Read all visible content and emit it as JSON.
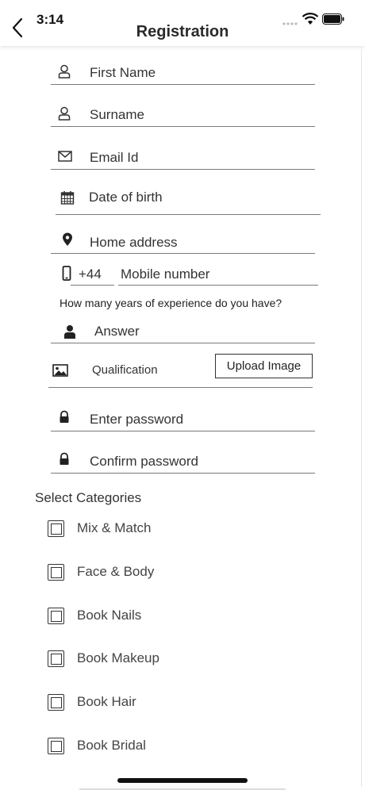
{
  "status": {
    "time": "3:14"
  },
  "header": {
    "title": "Registration"
  },
  "fields": {
    "first_name": "First Name",
    "surname": "Surname",
    "email": "Email Id",
    "dob": "Date of birth",
    "address": "Home address",
    "country_code": "+44",
    "mobile": "Mobile number",
    "experience_question": "How many years of experience do you have?",
    "answer": "Answer",
    "qualification": "Qualification",
    "upload_label": "Upload Image",
    "password": "Enter password",
    "confirm_password": "Confirm password"
  },
  "categories": {
    "title": "Select Categories",
    "items": [
      {
        "label": "Mix & Match",
        "checked": false
      },
      {
        "label": "Face & Body",
        "checked": false
      },
      {
        "label": "Book Nails",
        "checked": false
      },
      {
        "label": "Book Makeup",
        "checked": false
      },
      {
        "label": "Book Hair",
        "checked": false
      },
      {
        "label": "Book Bridal",
        "checked": false
      }
    ]
  },
  "icons": {
    "back": "chevron-left-icon",
    "wifi": "wifi-icon",
    "battery": "battery-icon",
    "user": "user-icon",
    "email": "envelope-icon",
    "calendar": "calendar-icon",
    "location": "location-pin-icon",
    "phone": "phone-icon",
    "person": "person-icon",
    "image": "image-icon",
    "lock": "lock-icon"
  }
}
